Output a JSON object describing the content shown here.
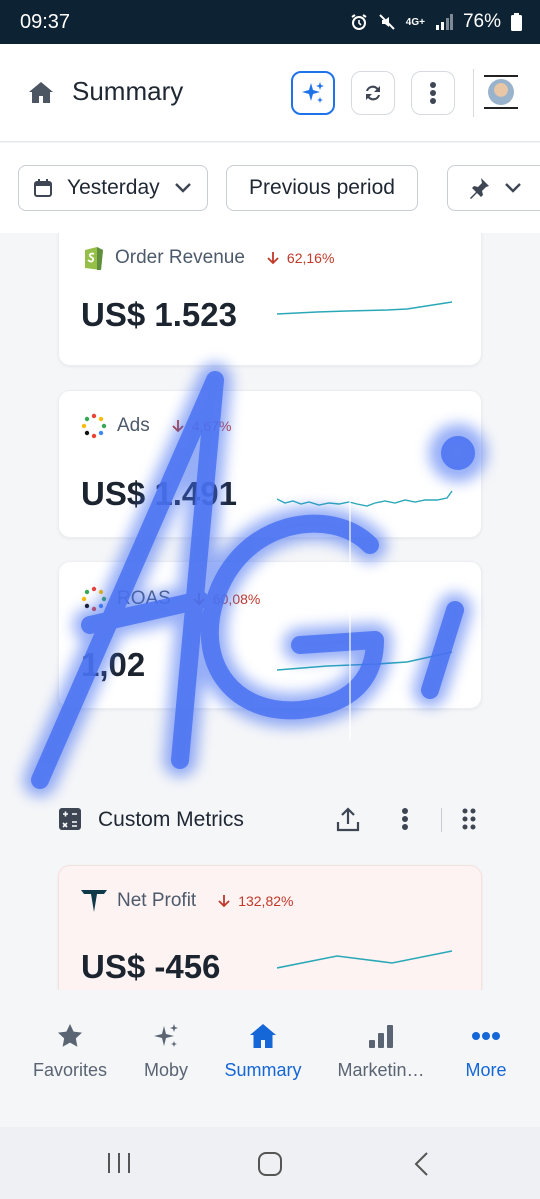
{
  "status_bar": {
    "time": "09:37",
    "network": "4G+",
    "battery": "76%"
  },
  "header": {
    "title": "Summary"
  },
  "filters": {
    "period": "Yesterday",
    "comparison": "Previous period"
  },
  "metrics": [
    {
      "name": "Order Revenue",
      "delta": "62,16%",
      "value": "US$ 1.523"
    },
    {
      "name": "Ads",
      "delta": "4,67%",
      "value": "US$ 1.491"
    },
    {
      "name": "ROAS",
      "delta": "60,08%",
      "value": "1,02"
    }
  ],
  "custom_metrics": {
    "title": "Custom Metrics",
    "items": [
      {
        "name": "Net Profit",
        "delta": "132,82%",
        "value": "US$ -456"
      }
    ]
  },
  "bottom_nav": [
    {
      "label": "Favorites",
      "icon": "star-icon"
    },
    {
      "label": "Moby",
      "icon": "sparkle-icon"
    },
    {
      "label": "Summary",
      "icon": "home-icon"
    },
    {
      "label": "Marketin…",
      "icon": "bar-chart-icon"
    },
    {
      "label": "More",
      "icon": "more-dots-icon"
    }
  ],
  "overlay_text": "AGI",
  "colors": {
    "accent": "#1566d6",
    "negative": "#c0392b",
    "spark": "#2aa8b8",
    "scribble": "#3f6cf0"
  }
}
